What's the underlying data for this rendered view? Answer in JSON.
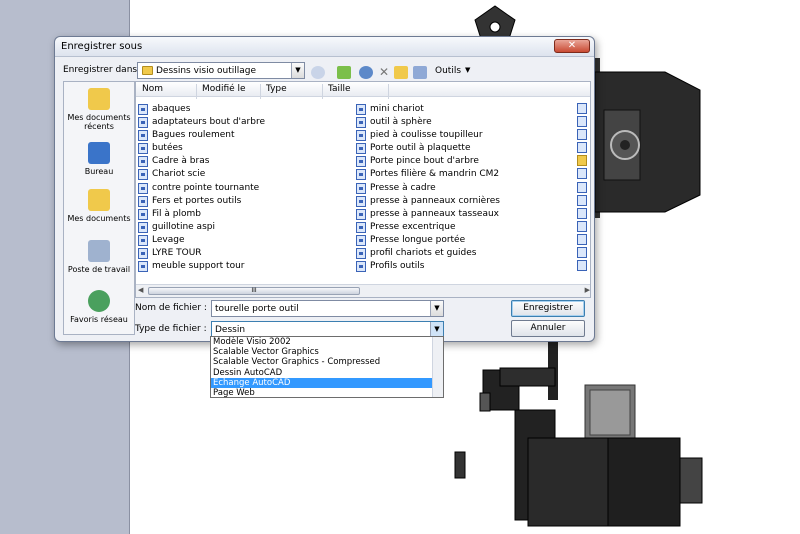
{
  "dialog": {
    "title": "Enregistrer sous",
    "close_label": "✕",
    "save_in_label": "Enregistrer dans :",
    "current_folder": "Dessins visio outillage",
    "tools_label": "Outils"
  },
  "places": [
    {
      "label": "Mes documents récents",
      "icon": "recent-documents-icon"
    },
    {
      "label": "Bureau",
      "icon": "desktop-icon"
    },
    {
      "label": "Mes documents",
      "icon": "my-documents-icon"
    },
    {
      "label": "Poste de travail",
      "icon": "my-computer-icon"
    },
    {
      "label": "Favoris réseau",
      "icon": "network-places-icon"
    }
  ],
  "columns": [
    "Nom",
    "Modifié le",
    "Type",
    "Taille"
  ],
  "files_col1": [
    "abaques",
    "adaptateurs bout d'arbre",
    "Bagues roulement",
    "butées",
    "Cadre à bras",
    "Chariot scie",
    "contre pointe tournante",
    "Fers et portes outils",
    "Fil à plomb",
    "guillotine aspi",
    "Levage",
    "LYRE TOUR",
    "meuble support tour"
  ],
  "files_col2": [
    "mini chariot",
    "outil à sphère",
    "pied à coulisse toupilleur",
    "Porte outil à plaquette",
    "Porte pince bout d'arbre",
    "Portes filière & mandrin CM2",
    "Presse à cadre",
    "presse à panneaux cornières",
    "presse à panneaux tasseaux",
    "Presse excentrique",
    "Presse longue portée",
    "profil chariots et guides",
    "Profils outils"
  ],
  "scroll_thumb_label": "III",
  "filename": {
    "label": "Nom de fichier :",
    "value": "tourelle porte outil"
  },
  "filetype": {
    "label": "Type de fichier :",
    "value": "Dessin"
  },
  "buttons": {
    "save": "Enregistrer",
    "cancel": "Annuler"
  },
  "filetype_options": [
    "Modèle Visio 2002",
    "Scalable Vector Graphics",
    "Scalable Vector Graphics - Compressed",
    "Dessin AutoCAD",
    "Echange AutoCAD",
    "Page Web"
  ],
  "filetype_selected_index": 4,
  "colors": {
    "selection": "#3399ff",
    "close_button": "#c94a33",
    "side_strip": "#b7bdcd"
  }
}
